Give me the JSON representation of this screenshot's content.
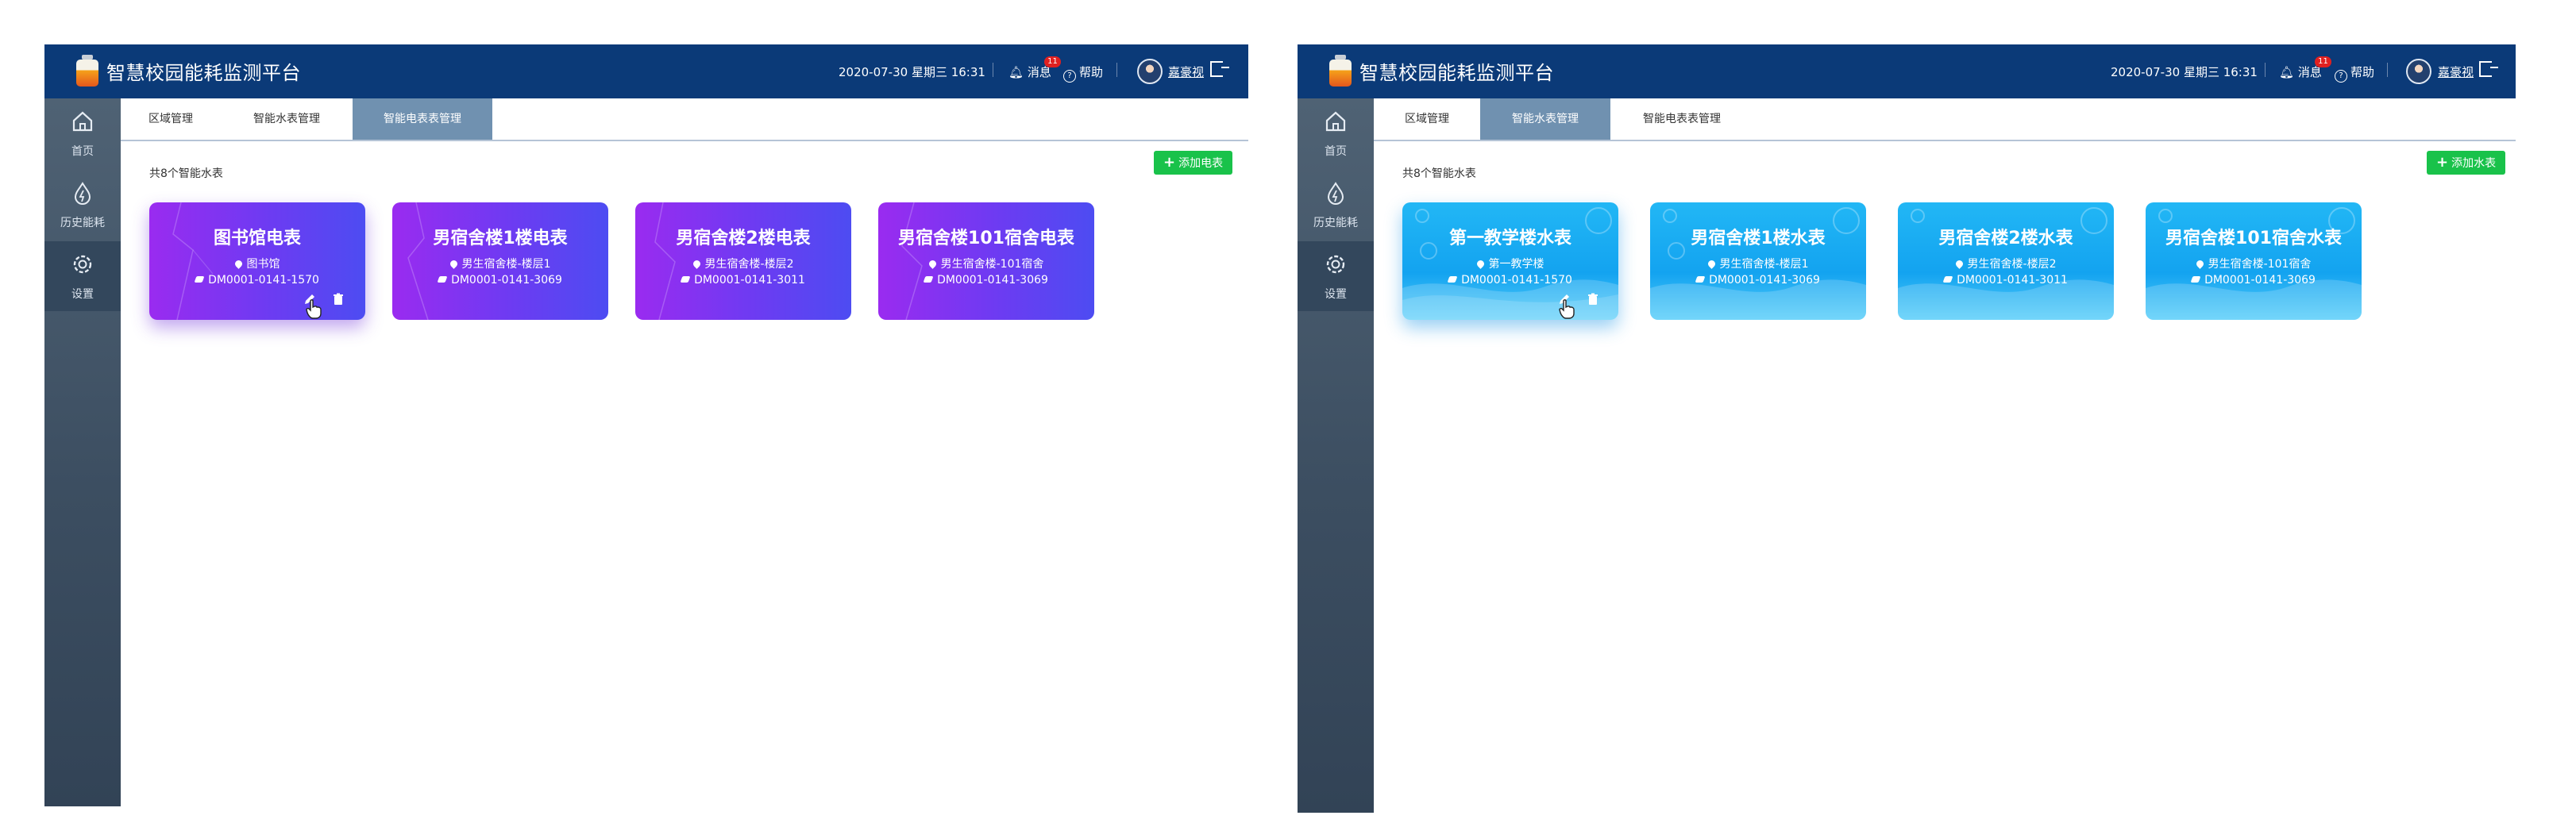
{
  "app": {
    "title": "智慧校园能耗监测平台",
    "datetime": "2020-07-30 星期三 16:31",
    "notifications_label": "消息",
    "notifications_count": "11",
    "help_label": "帮助",
    "username": "嘉豪视",
    "colors": {
      "header": "#0b3a78",
      "sidebar": "#3c4e61",
      "active_tab": "#7091b0",
      "add_button": "#19c24a"
    }
  },
  "sidebar": {
    "items": [
      {
        "label": "首页",
        "icon": "home-icon"
      },
      {
        "label": "历史能耗",
        "icon": "energy-drop-icon"
      },
      {
        "label": "设置",
        "icon": "gear-icon"
      }
    ]
  },
  "tabs": [
    "区域管理",
    "智能水表管理",
    "智能电表表管理"
  ],
  "left_panel": {
    "active_tab": "智能电表表管理",
    "count_text": "共8个智能水表",
    "add_button": "添加电表",
    "cards": [
      {
        "name": "图书馆电表",
        "location": "图书馆",
        "code": "DM0001-0141-1570"
      },
      {
        "name": "男宿舍楼1楼电表",
        "location": "男生宿舍楼-楼层1",
        "code": "DM0001-0141-3069"
      },
      {
        "name": "男宿舍楼2楼电表",
        "location": "男生宿舍楼-楼层2",
        "code": "DM0001-0141-3011"
      },
      {
        "name": "男宿舍楼101宿舍电表",
        "location": "男生宿舍楼-101宿舍",
        "code": "DM0001-0141-3069"
      }
    ]
  },
  "right_panel": {
    "active_tab": "智能水表管理",
    "count_text": "共8个智能水表",
    "add_button": "添加水表",
    "cards": [
      {
        "name": "第一教学楼水表",
        "location": "第一教学楼",
        "code": "DM0001-0141-1570"
      },
      {
        "name": "男宿舍楼1楼水表",
        "location": "男生宿舍楼-楼层1",
        "code": "DM0001-0141-3069"
      },
      {
        "name": "男宿舍楼2楼水表",
        "location": "男生宿舍楼-楼层2",
        "code": "DM0001-0141-3011"
      },
      {
        "name": "男宿舍楼101宿舍水表",
        "location": "男生宿舍楼-101宿舍",
        "code": "DM0001-0141-3069"
      }
    ]
  }
}
